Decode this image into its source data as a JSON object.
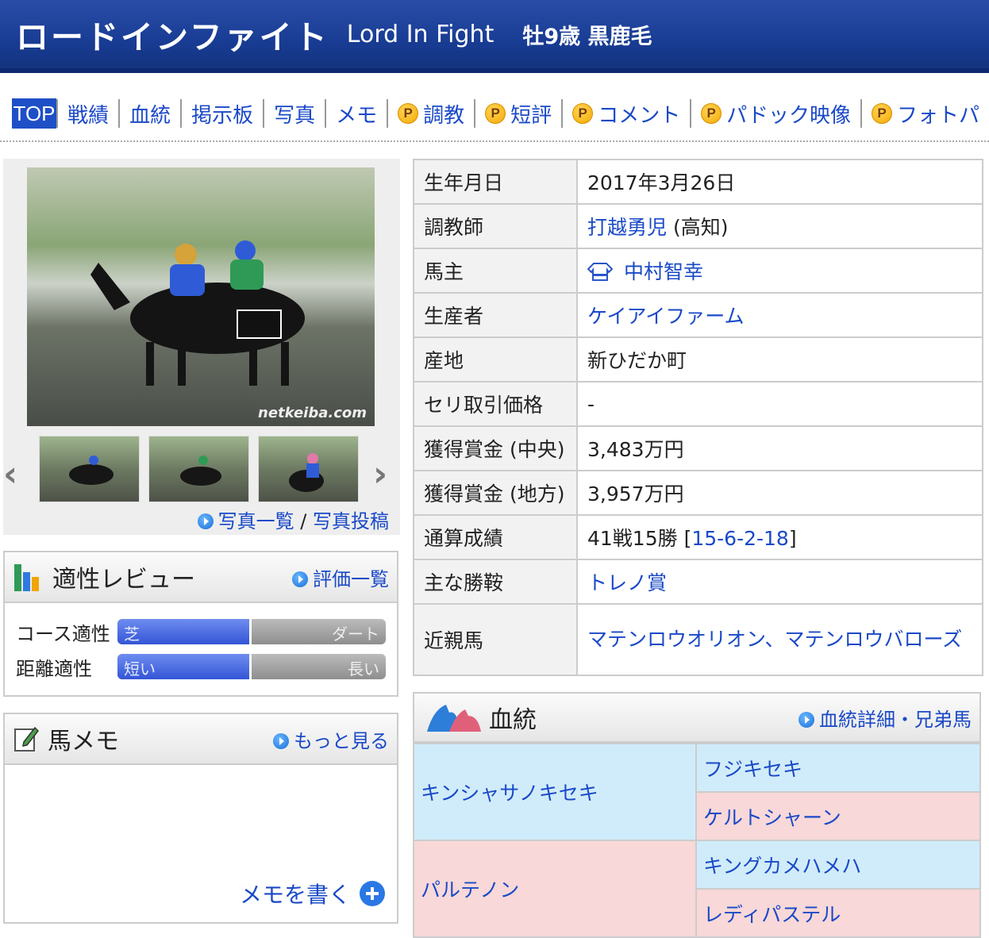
{
  "header": {
    "name_jp": "ロードインファイト",
    "name_en": "Lord In Fight",
    "info": "牡9歳 黒鹿毛"
  },
  "nav": {
    "items": [
      "TOP",
      "戦績",
      "血統",
      "掲示板",
      "写真",
      "メモ",
      "調教",
      "短評",
      "コメント",
      "パドック映像",
      "フォトパ"
    ],
    "premium_badge": "P"
  },
  "photo": {
    "watermark": "netkeiba.com",
    "prev_arrow": "‹",
    "next_arrow": "›",
    "links": {
      "list": "写真一覧",
      "separator": " / ",
      "post": "写真投稿"
    }
  },
  "aptitude": {
    "title": "適性レビュー",
    "link": "評価一覧",
    "rows": [
      {
        "label": "コース適性",
        "left": "芝",
        "right": "ダート",
        "value": 0.5
      },
      {
        "label": "距離適性",
        "left": "短い",
        "right": "長い",
        "value": 0.5
      }
    ]
  },
  "memo": {
    "title": "馬メモ",
    "link": "もっと見る",
    "write": "メモを書く"
  },
  "profile": [
    {
      "key": "生年月日",
      "value": "2017年3月26日"
    },
    {
      "key": "調教師",
      "value": "打越勇児",
      "suffix": " (高知)"
    },
    {
      "key": "馬主",
      "value": "中村智幸"
    },
    {
      "key": "生産者",
      "value": "ケイアイファーム"
    },
    {
      "key": "産地",
      "value": "新ひだか町"
    },
    {
      "key": "セリ取引価格",
      "value": "-"
    },
    {
      "key": "獲得賞金 (中央)",
      "value": "3,483万円"
    },
    {
      "key": "獲得賞金 (地方)",
      "value": "3,957万円"
    },
    {
      "key": "通算成績",
      "value": "41戦15勝 [",
      "link": "15-6-2-18",
      "suffix": "]"
    },
    {
      "key": "主な勝鞍",
      "value": "トレノ賞"
    },
    {
      "key": "近親馬",
      "value": "マテンロウオリオン、マテンロウバローズ"
    }
  ],
  "pedigree": {
    "title": "血統",
    "link": "血統詳細・兄弟馬",
    "sire": "キンシャサノキセキ",
    "sire_sire": "フジキセキ",
    "sire_dam": "ケルトシャーン",
    "dam": "パルテノン",
    "dam_sire": "キングカメハメハ",
    "dam_dam": "レディパステル"
  },
  "colors": {
    "header_bg": "#193c94",
    "link": "#1a49c8",
    "male_cell": "#d0ecfa",
    "female_cell": "#f8d8d8"
  }
}
